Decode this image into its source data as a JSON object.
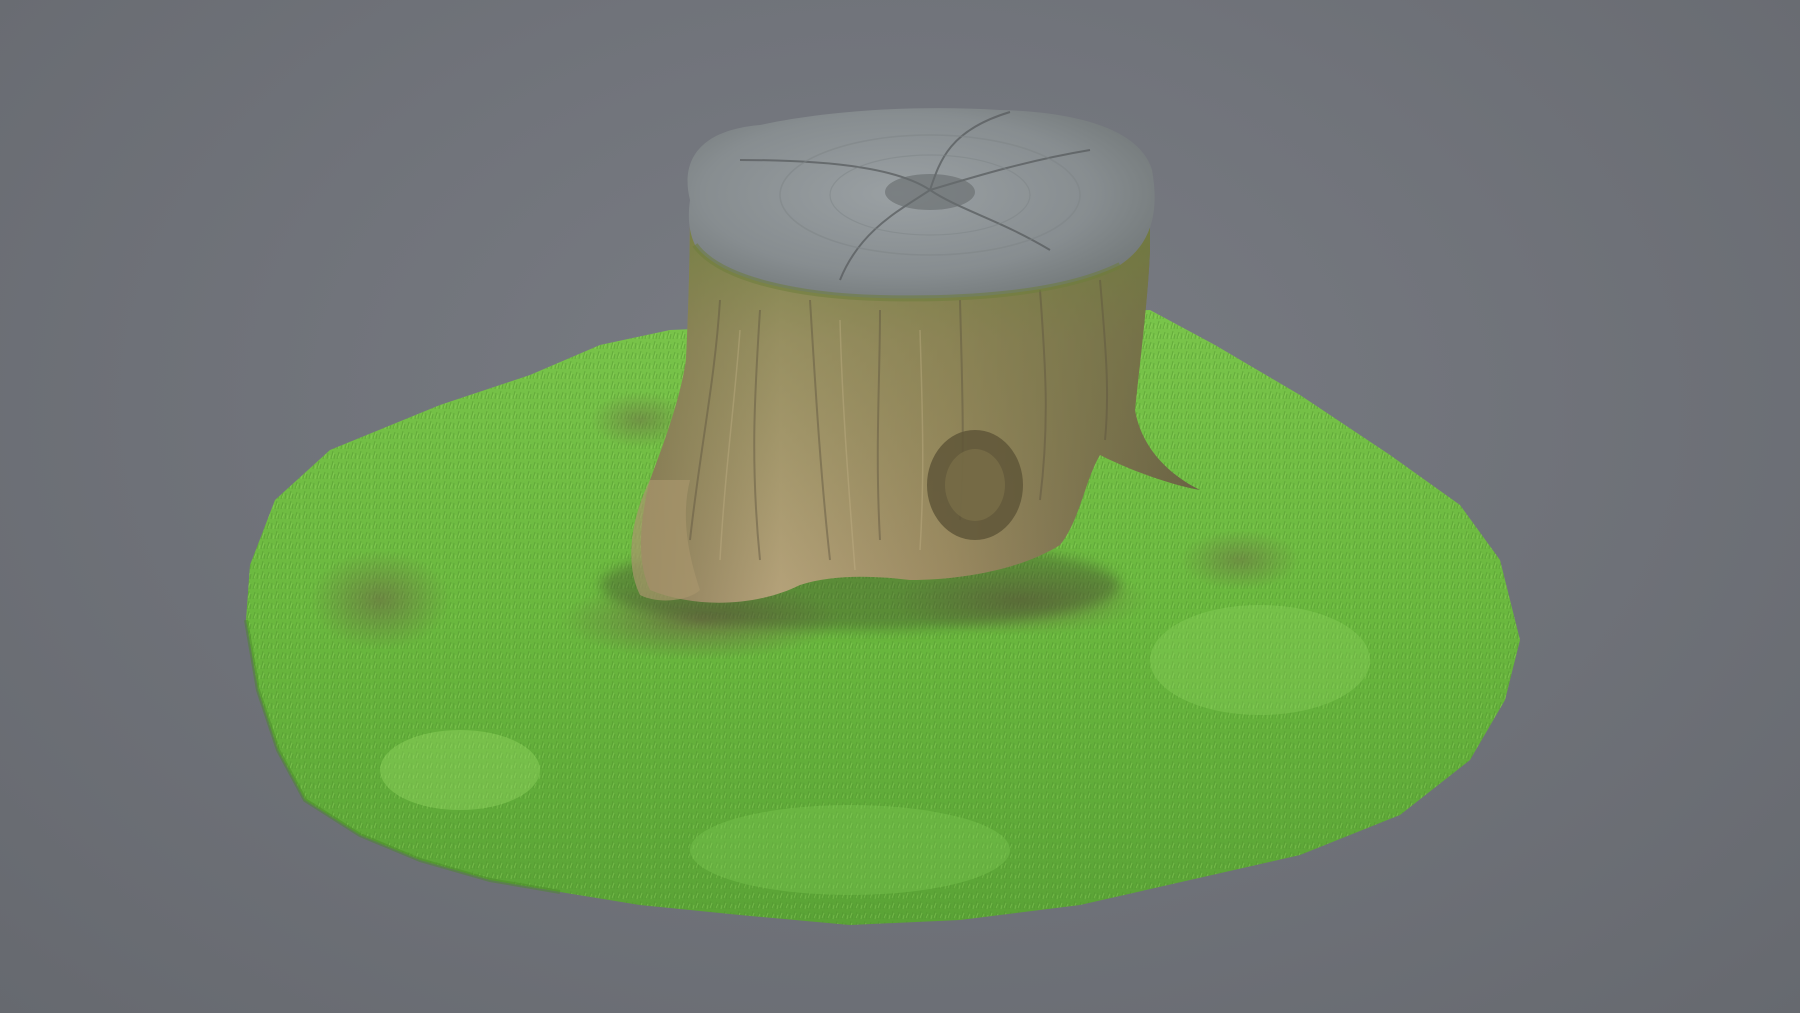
{
  "scene": {
    "subject": "tree-stump-on-grass-patch",
    "colors": {
      "background": "#71747b",
      "grass": "#5fa83a",
      "grass_light": "#8fd35a",
      "grass_dark": "#3f7a2a",
      "dirt": "#6b5a43",
      "bark": "#9a8a66",
      "bark_dark": "#5e5440",
      "top_face": "#8a9095",
      "moss": "#6c7f3c"
    }
  }
}
